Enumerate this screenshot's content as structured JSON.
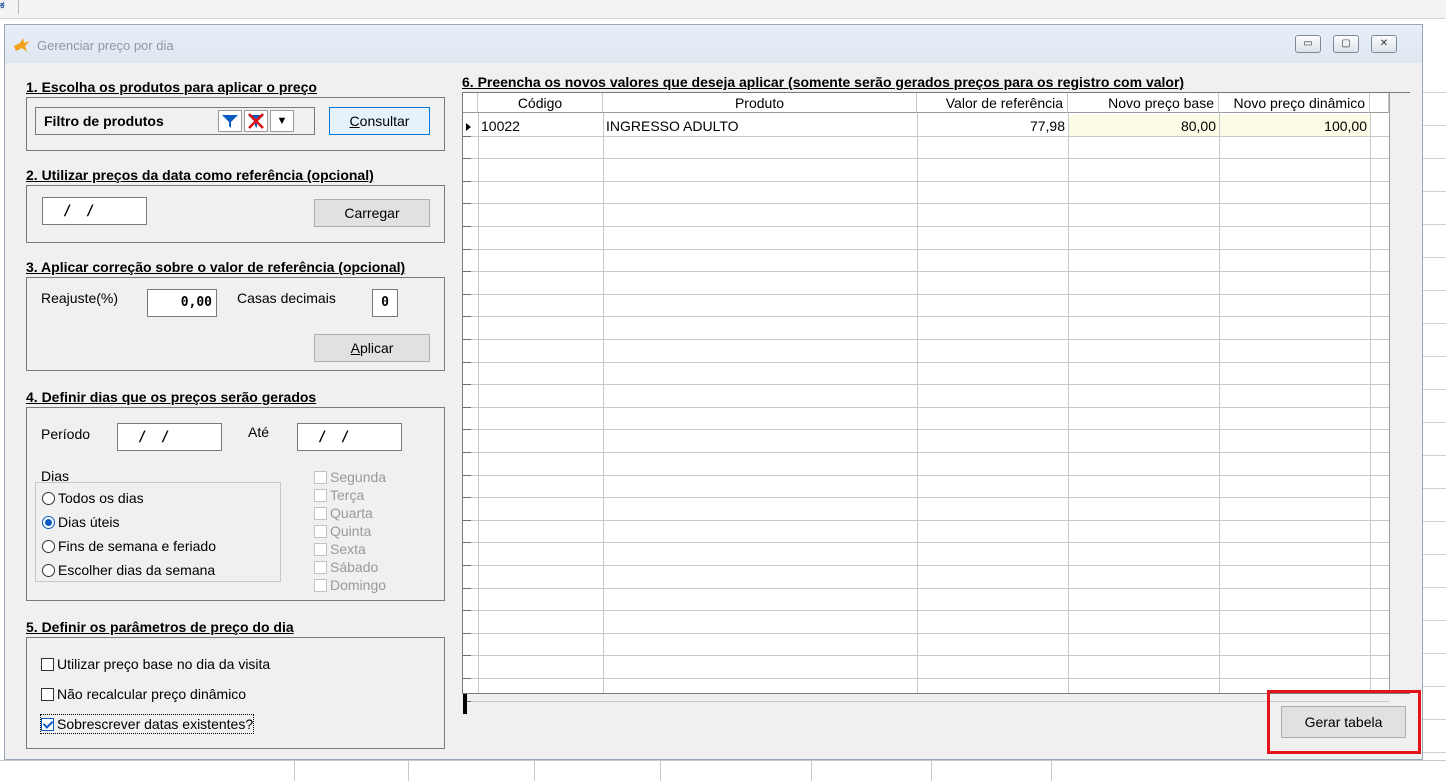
{
  "app": {
    "icon_text": "ಕ"
  },
  "dialog": {
    "title": "Gerenciar preço por dia",
    "buttons": {
      "minimize": "▭",
      "maximize": "▢",
      "close": "✕"
    }
  },
  "section1": {
    "label": "1. Escolha os produtos para aplicar o preço",
    "filter_label": "Filtro de produtos",
    "filter_dropdown": "▼",
    "consult_button_ul": "C",
    "consult_button_rest": "onsultar"
  },
  "section2": {
    "label": "2. Utilizar preços da data como referência (opcional)",
    "date_value": "/ /",
    "load_button": "Carregar"
  },
  "section3": {
    "label": "3. Aplicar correção sobre o valor de referência (opcional)",
    "reajuste_label": "Reajuste(%)",
    "reajuste_value": "0,00",
    "casas_label": "Casas decimais",
    "casas_value": "0",
    "apply_button_ul": "A",
    "apply_button_rest": "plicar"
  },
  "section4": {
    "label": "4. Definir dias que os preços serão gerados",
    "periodo_label": "Período",
    "periodo_value": "/ /",
    "ate_label": "Até",
    "ate_value": "/ /",
    "dias_label": "Dias",
    "radios": [
      {
        "label": "Todos os dias",
        "checked": false
      },
      {
        "label": "Dias úteis",
        "checked": true
      },
      {
        "label": "Fins de semana e feriado",
        "checked": false
      },
      {
        "label": "Escolher dias da semana",
        "checked": false
      }
    ],
    "weekdays": [
      "Segunda",
      "Terça",
      "Quarta",
      "Quinta",
      "Sexta",
      "Sábado",
      "Domingo"
    ]
  },
  "section5": {
    "label": "5. Definir os parâmetros de preço do dia",
    "options": [
      {
        "label": "Utilizar preço base no dia da visita",
        "checked": false
      },
      {
        "label": "Não recalcular preço dinâmico",
        "checked": false
      },
      {
        "label": "Sobrescrever datas existentes?",
        "checked": true
      }
    ]
  },
  "section6": {
    "label": "6. Preencha os novos valores que deseja aplicar (somente serão gerados preços para os registro com valor)",
    "columns": [
      "Código",
      "Produto",
      "Valor de referência",
      "Novo preço base",
      "Novo preço dinâmico"
    ],
    "rows": [
      [
        "10022",
        "INGRESSO ADULTO",
        "77,98",
        "80,00",
        "100,00"
      ]
    ]
  },
  "footer": {
    "generate_button": "Gerar tabela"
  },
  "colors": {
    "accent": "#0a5bc4",
    "highlight": "#e3141b",
    "edit_cell": "#fcfbe6"
  }
}
